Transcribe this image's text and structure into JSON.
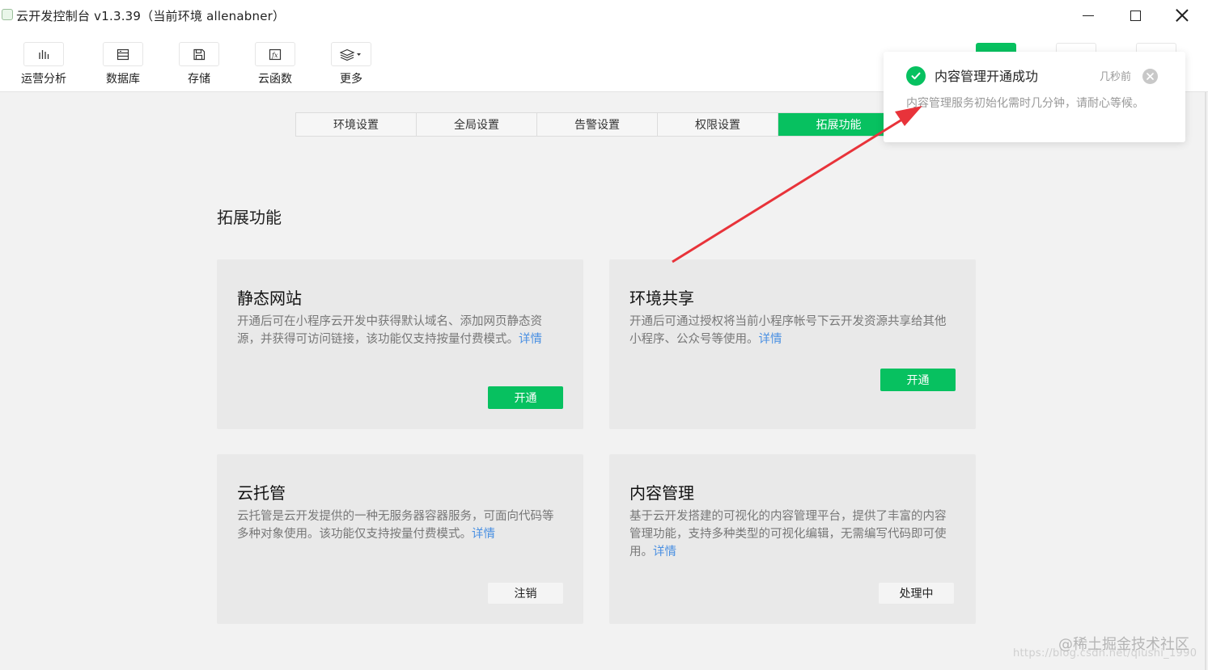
{
  "window": {
    "title": "云开发控制台 v1.3.39（当前环境 allenabner）"
  },
  "toolbar": {
    "items": [
      {
        "label": "运营分析",
        "icon": "bar-chart-icon"
      },
      {
        "label": "数据库",
        "icon": "database-icon"
      },
      {
        "label": "存储",
        "icon": "storage-icon"
      },
      {
        "label": "云函数",
        "icon": "function-icon"
      },
      {
        "label": "更多",
        "icon": "layers-icon"
      }
    ]
  },
  "tabs": [
    {
      "label": "环境设置",
      "active": false
    },
    {
      "label": "全局设置",
      "active": false
    },
    {
      "label": "告警设置",
      "active": false
    },
    {
      "label": "权限设置",
      "active": false
    },
    {
      "label": "拓展功能",
      "active": true
    }
  ],
  "section": {
    "title": "拓展功能"
  },
  "cards": [
    {
      "title": "静态网站",
      "desc": "开通后可在小程序云开发中获得默认域名、添加网页静态资源，并获得可访问链接，该功能仅支持按量付费模式。",
      "link": "详情",
      "button": "开通",
      "button_style": "primary"
    },
    {
      "title": "环境共享",
      "desc": "开通后可通过授权将当前小程序帐号下云开发资源共享给其他小程序、公众号等使用。",
      "link": "详情",
      "button": "开通",
      "button_style": "primary"
    },
    {
      "title": "云托管",
      "desc": "云托管是云开发提供的一种无服务器容器服务，可面向代码等多种对象使用。该功能仅支持按量付费模式。",
      "link": "详情",
      "button": "注销",
      "button_style": "plain"
    },
    {
      "title": "内容管理",
      "desc": "基于云开发搭建的可视化的内容管理平台，提供了丰富的内容管理功能，支持多种类型的可视化编辑，无需编写代码即可使用。",
      "link": "详情",
      "button": "处理中",
      "button_style": "plain"
    }
  ],
  "notification": {
    "title": "内容管理开通成功",
    "time": "几秒前",
    "message": "内容管理服务初始化需时几分钟，请耐心等候。"
  },
  "watermark": {
    "main": "@稀土掘金技术社区",
    "sub": "https://blog.csdn.net/qiushi_1990"
  },
  "colors": {
    "accent": "#07c160",
    "link": "#4a90e2",
    "annotation_arrow": "#e8333a"
  }
}
